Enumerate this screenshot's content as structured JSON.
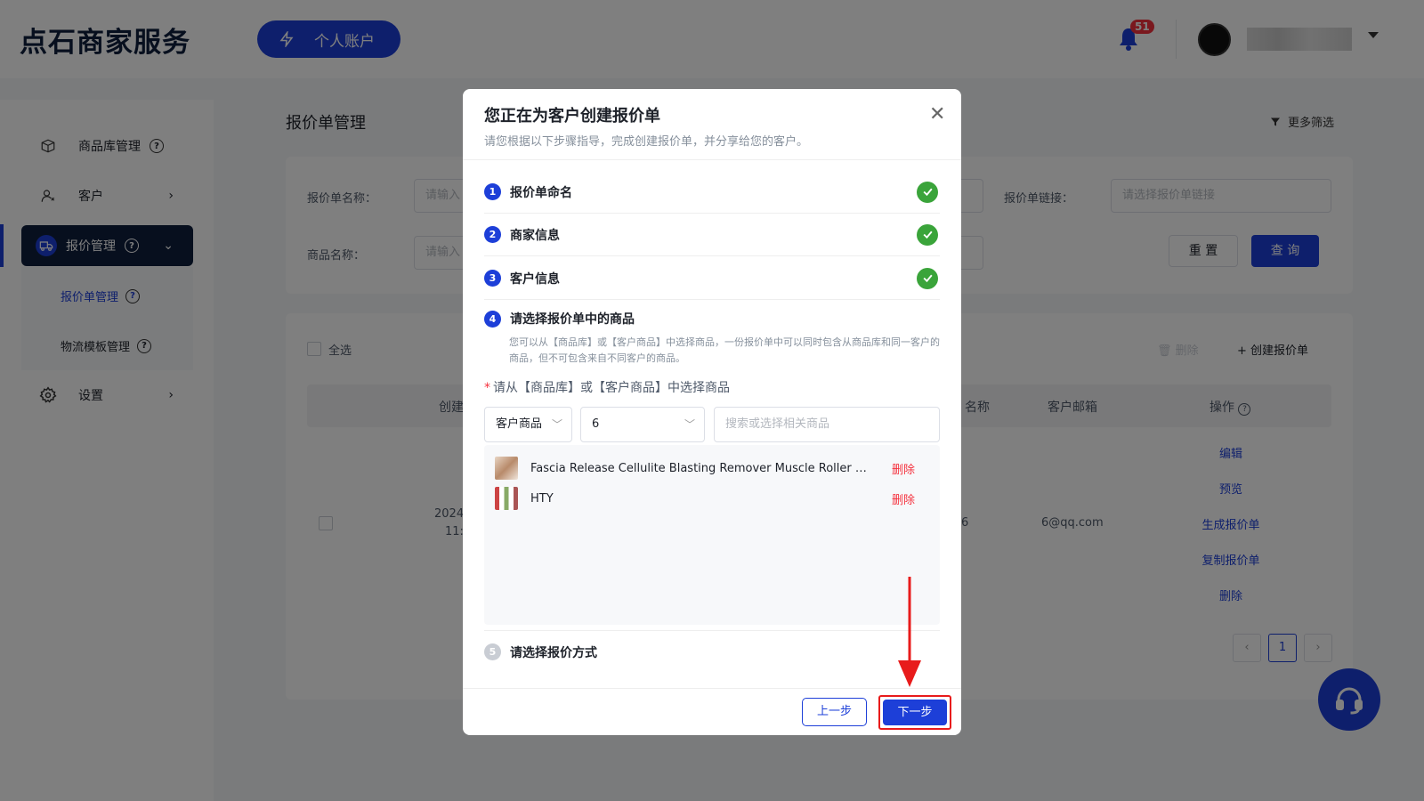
{
  "header": {
    "logo": "点石商家服务",
    "account_button": "个人账户",
    "notification_count": "51",
    "user_name": ""
  },
  "sidebar": {
    "items": [
      {
        "label": "商品库管理",
        "icon": "box-icon",
        "has_help": true
      },
      {
        "label": "客户",
        "icon": "user-icon"
      },
      {
        "label": "报价管理",
        "icon": "truck-icon",
        "has_help": true,
        "active": true
      },
      {
        "label": "设置",
        "icon": "gear-icon"
      }
    ],
    "subitems": [
      {
        "label": "报价单管理",
        "active": true
      },
      {
        "label": "物流模板管理"
      }
    ]
  },
  "main": {
    "page_title": "报价单管理",
    "more_filter": "更多筛选",
    "filters": {
      "quote_name_label": "报价单名称：",
      "quote_name_placeholder": "请输入",
      "product_name_label": "商品名称：",
      "product_name_placeholder": "请输入",
      "quote_link_label": "报价单链接：",
      "quote_link_placeholder": "请选择报价单链接",
      "reset": "重 置",
      "query": "查 询"
    },
    "table": {
      "select_all": "全选",
      "delete": "删除",
      "create": "创建报价单",
      "columns": [
        "创建",
        "名称",
        "客户邮箱",
        "操作"
      ],
      "row": {
        "date": "2024",
        "time": "11:",
        "name_partial": "6",
        "email": "6@qq.com"
      },
      "actions": [
        "编辑",
        "预览",
        "生成报价单",
        "复制报价单",
        "删除"
      ],
      "current_page": "1"
    }
  },
  "modal": {
    "title": "您正在为客户创建报价单",
    "subtitle": "请您根据以下步骤指导，完成创建报价单，并分享给您的客户。",
    "steps": [
      {
        "num": "1",
        "label": "报价单命名",
        "done": true
      },
      {
        "num": "2",
        "label": "商家信息",
        "done": true
      },
      {
        "num": "3",
        "label": "客户信息",
        "done": true
      },
      {
        "num": "4",
        "label": "请选择报价单中的商品",
        "done": false
      },
      {
        "num": "5",
        "label": "请选择报价方式",
        "done": false
      }
    ],
    "step4_desc": "您可以从【商品库】或【客户商品】中选择商品，一份报价单中可以同时包含从商品库和同一客户的商品，但不可包含来自不同客户的商品。",
    "product_select_label": "请从【商品库】或【客户商品】中选择商品",
    "source_select": "客户商品",
    "customer_select": "6",
    "search_placeholder": "搜索或选择相关商品",
    "products": [
      {
        "name": "Fascia Release Cellulite Blasting Remover Muscle Roller Massage Stick",
        "action": "删除"
      },
      {
        "name": "HTY",
        "action": "删除"
      }
    ],
    "prev_button": "上一步",
    "next_button": "下一步"
  },
  "colors": {
    "primary": "#1d3fd8",
    "dark_nav": "#0f1f3d",
    "success": "#3aa43a",
    "danger": "#f5313d",
    "highlight": "#e81b1b"
  }
}
